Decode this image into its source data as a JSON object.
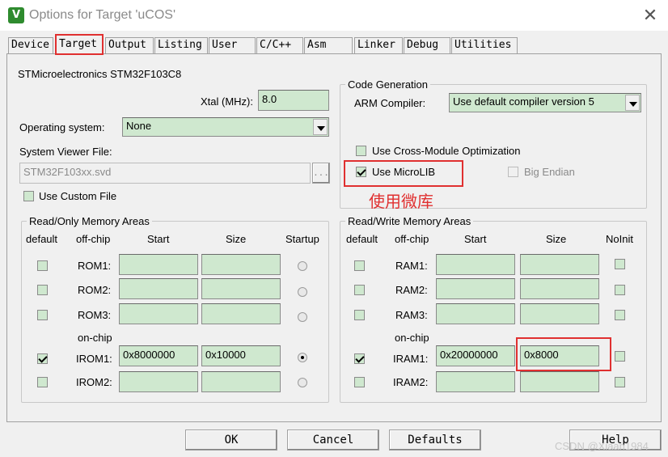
{
  "window": {
    "title": "Options for Target 'uCOS'",
    "icon": "keil-uvision-icon",
    "close": "✕"
  },
  "tabs": [
    "Device",
    "Target",
    "Output",
    "Listing",
    "User",
    "C/C++",
    "Asm",
    "Linker",
    "Debug",
    "Utilities"
  ],
  "active_tab": "Target",
  "target": {
    "device_name": "STMicroelectronics STM32F103C8",
    "xtal_label": "Xtal (MHz):",
    "xtal_value": "8.0",
    "os_label": "Operating system:",
    "os_value": "None",
    "svd_label": "System Viewer File:",
    "svd_value": "STM32F103xx.svd",
    "svd_browse": "...",
    "custom_file_label": "Use Custom File",
    "custom_file_checked": false
  },
  "code_generation": {
    "title": "Code Generation",
    "compiler_label": "ARM Compiler:",
    "compiler_value": "Use default compiler version 5",
    "cross_module_label": "Use Cross-Module Optimization",
    "cross_module_checked": false,
    "microlib_label": "Use MicroLIB",
    "microlib_checked": true,
    "big_endian_label": "Big Endian",
    "big_endian_checked": false,
    "annotation": "使用微库"
  },
  "rom_areas": {
    "title": "Read/Only Memory Areas",
    "headers": {
      "default": "default",
      "offchip": "off-chip",
      "start": "Start",
      "size": "Size",
      "startup": "Startup"
    },
    "onchip_label": "on-chip",
    "rows": [
      {
        "name": "ROM1:",
        "start": "",
        "size": "",
        "default": false,
        "startup": false
      },
      {
        "name": "ROM2:",
        "start": "",
        "size": "",
        "default": false,
        "startup": false
      },
      {
        "name": "ROM3:",
        "start": "",
        "size": "",
        "default": false,
        "startup": false
      },
      {
        "name": "IROM1:",
        "start": "0x8000000",
        "size": "0x10000",
        "default": true,
        "startup": true
      },
      {
        "name": "IROM2:",
        "start": "",
        "size": "",
        "default": false,
        "startup": false
      }
    ]
  },
  "ram_areas": {
    "title": "Read/Write Memory Areas",
    "headers": {
      "default": "default",
      "offchip": "off-chip",
      "start": "Start",
      "size": "Size",
      "noinit": "NoInit"
    },
    "onchip_label": "on-chip",
    "rows": [
      {
        "name": "RAM1:",
        "start": "",
        "size": "",
        "default": false,
        "noinit": false
      },
      {
        "name": "RAM2:",
        "start": "",
        "size": "",
        "default": false,
        "noinit": false
      },
      {
        "name": "RAM3:",
        "start": "",
        "size": "",
        "default": false,
        "noinit": false
      },
      {
        "name": "IRAM1:",
        "start": "0x20000000",
        "size": "0x8000",
        "default": true,
        "noinit": false
      },
      {
        "name": "IRAM2:",
        "start": "",
        "size": "",
        "default": false,
        "noinit": false
      }
    ]
  },
  "buttons": {
    "ok": "OK",
    "cancel": "Cancel",
    "defaults": "Defaults",
    "help": "Help"
  },
  "watermark": "CSDN @Xiaan1984",
  "colors": {
    "field_bg": "#cfe8cf",
    "highlight": "#e03030"
  }
}
